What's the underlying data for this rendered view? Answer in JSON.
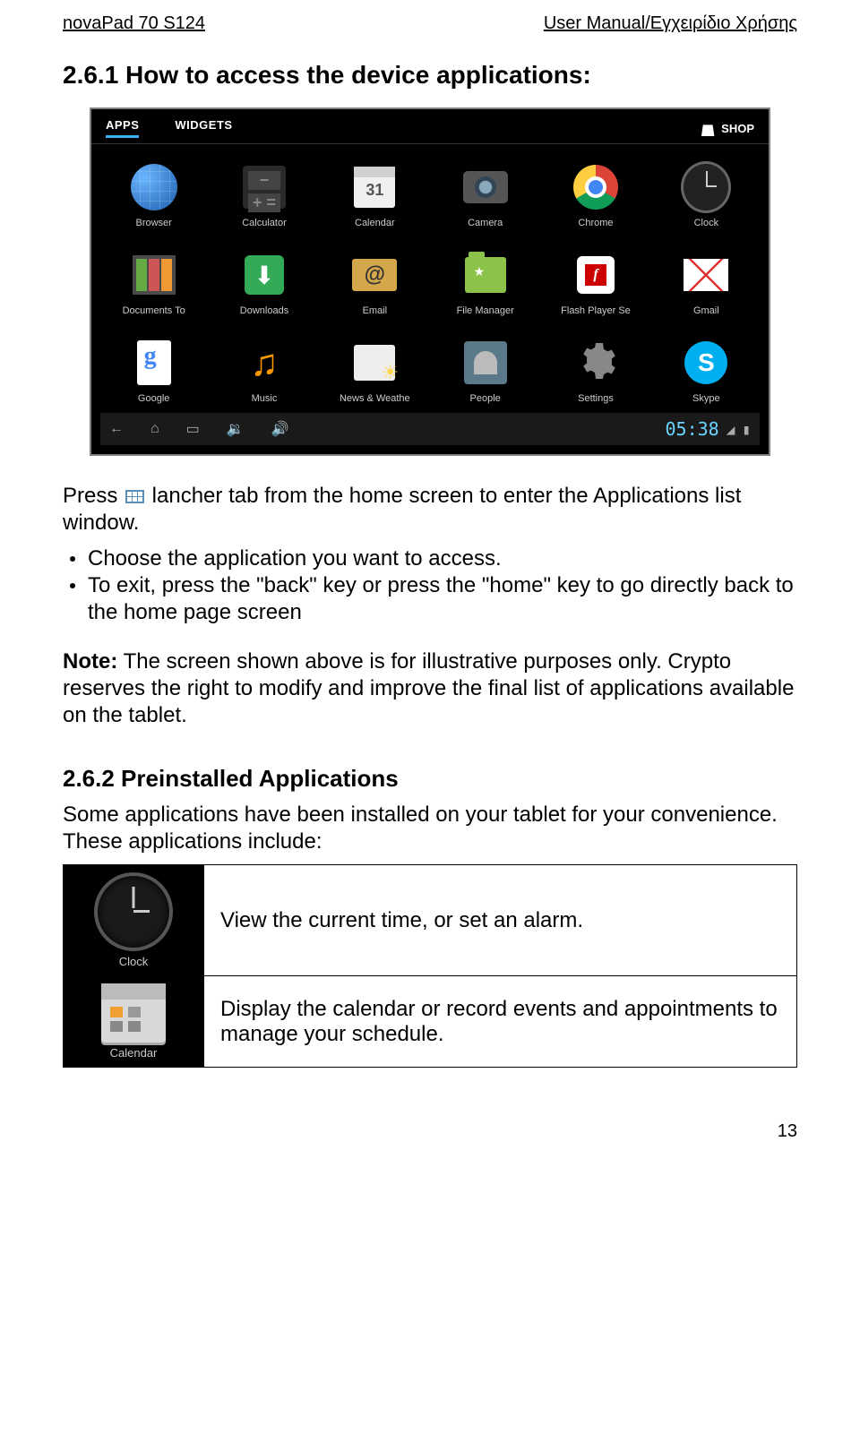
{
  "header": {
    "left": "novaPad 70 S124",
    "right": "User Manual/Εγχειρίδιο Χρήσης"
  },
  "h1": "2.6.1 How to access the device applications:",
  "tablet": {
    "tabs": {
      "apps": "APPS",
      "widgets": "WIDGETS",
      "shop": "SHOP"
    },
    "apps": [
      {
        "label": "Browser"
      },
      {
        "label": "Calculator"
      },
      {
        "label": "Calendar"
      },
      {
        "label": "Camera"
      },
      {
        "label": "Chrome"
      },
      {
        "label": "Clock"
      },
      {
        "label": "Documents To"
      },
      {
        "label": "Downloads"
      },
      {
        "label": "Email"
      },
      {
        "label": "File Manager"
      },
      {
        "label": "Flash Player Se"
      },
      {
        "label": "Gmail"
      },
      {
        "label": "Google"
      },
      {
        "label": "Music"
      },
      {
        "label": "News & Weathe"
      },
      {
        "label": "People"
      },
      {
        "label": "Settings"
      },
      {
        "label": "Skype"
      }
    ],
    "time": "05:38"
  },
  "p_press_1": "Press ",
  "p_press_2": " lancher tab from the home screen to enter the Applications list window.",
  "bullets": {
    "b1": "Choose the application you want to access.",
    "b2": "To exit, press the \"back\" key or press the \"home\" key to go directly back to the home page screen"
  },
  "note_label": "Note:",
  "note_body": " The screen shown above is for illustrative purposes only. Crypto reserves the right to modify and improve the final list of applications available on the tablet.",
  "h2": "2.6.2 Preinstalled Applications",
  "p2": "Some applications have been installed on your tablet for your convenience. These applications include:",
  "table": {
    "row1": {
      "label": "Clock",
      "desc": "View the current time, or set an alarm."
    },
    "row2": {
      "label": "Calendar",
      "desc": "Display the calendar or record events and appointments to manage your schedule."
    }
  },
  "page_number": "13"
}
